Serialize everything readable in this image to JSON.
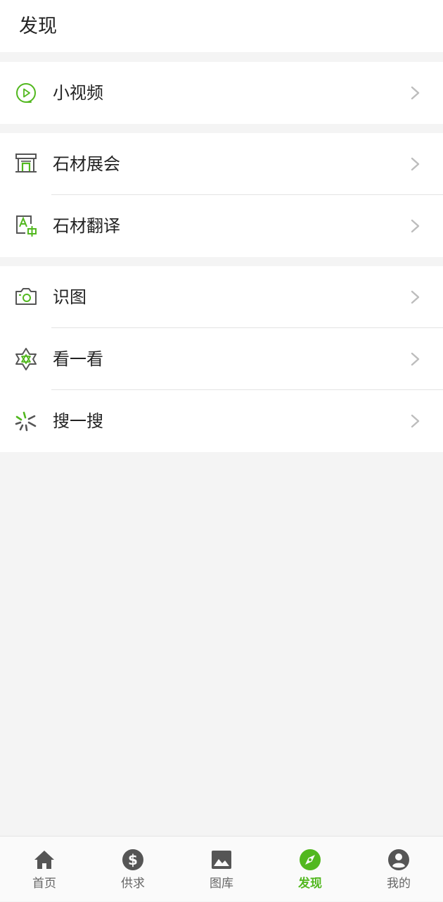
{
  "header": {
    "title": "发现"
  },
  "groups": [
    {
      "items": [
        {
          "label": "小视频",
          "icon": "play-circle-icon"
        }
      ]
    },
    {
      "items": [
        {
          "label": "石材展会",
          "icon": "exhibition-icon"
        },
        {
          "label": "石材翻译",
          "icon": "translate-icon"
        }
      ]
    },
    {
      "items": [
        {
          "label": "识图",
          "icon": "camera-icon"
        },
        {
          "label": "看一看",
          "icon": "star-look-icon"
        },
        {
          "label": "搜一搜",
          "icon": "search-spark-icon"
        }
      ]
    }
  ],
  "tabbar": {
    "tabs": [
      {
        "label": "首页",
        "icon": "home-icon"
      },
      {
        "label": "供求",
        "icon": "dollar-icon"
      },
      {
        "label": "图库",
        "icon": "image-icon"
      },
      {
        "label": "发现",
        "icon": "compass-icon",
        "active": true
      },
      {
        "label": "我的",
        "icon": "user-icon"
      }
    ]
  },
  "colors": {
    "accent": "#52b81f",
    "icon_gray": "#555555",
    "chevron": "#bdbdbd",
    "background": "#f4f4f4"
  }
}
